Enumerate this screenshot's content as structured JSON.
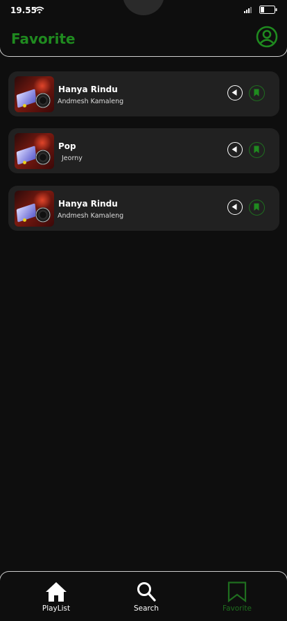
{
  "status_bar": {
    "time": "19.55",
    "icons": [
      "wifi-icon",
      "signal-icon",
      "battery-icon"
    ]
  },
  "header": {
    "title": "Favorite",
    "profile_icon": "user-circle-icon",
    "accent_color": "#1f8a1f"
  },
  "songs": [
    {
      "title": "Hanya Rindu",
      "artist": "Andmesh Kamaleng",
      "play_icon": "play-reverse-icon",
      "bookmark_icon": "bookmark-icon"
    },
    {
      "title": "Pop",
      "artist": "Jeorny",
      "play_icon": "play-reverse-icon",
      "bookmark_icon": "bookmark-icon"
    },
    {
      "title": "Hanya Rindu",
      "artist": "Andmesh Kamaleng",
      "play_icon": "play-reverse-icon",
      "bookmark_icon": "bookmark-icon"
    }
  ],
  "bottom_nav": {
    "items": [
      {
        "label": "PlayList",
        "icon": "home-icon",
        "active": false
      },
      {
        "label": "Search",
        "icon": "search-icon",
        "active": false
      },
      {
        "label": "Favorite",
        "icon": "bookmark-icon",
        "active": true
      }
    ],
    "active_color": "#1f6e1f"
  },
  "colors": {
    "background": "#0e0e0e",
    "card": "#212121",
    "accent": "#1f8a1f"
  }
}
